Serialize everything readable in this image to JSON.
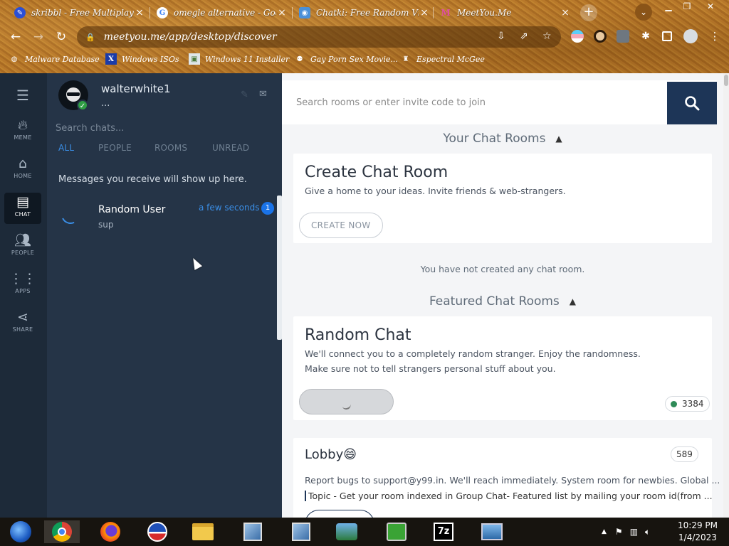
{
  "browser": {
    "tabs": [
      {
        "title": "skribbl - Free Multiplayer",
        "close": "×"
      },
      {
        "title": "omegle alternative - Goog",
        "close": "×"
      },
      {
        "title": "Chatki: Free Random Video",
        "close": "×"
      },
      {
        "title": "MeetYou.Me",
        "close": "×"
      }
    ],
    "new_tab": "+",
    "url": "meetyou.me/app/desktop/discover",
    "bookmarks": [
      {
        "label": "Malware Database"
      },
      {
        "label": "Windows ISOs"
      },
      {
        "label": "Windows 11 Installer"
      },
      {
        "label": "Gay Porn Sex Movie..."
      },
      {
        "label": "Espectral McGee"
      }
    ]
  },
  "rail": {
    "items": [
      {
        "label": "MEME",
        "icon": "flame-icon"
      },
      {
        "label": "HOME",
        "icon": "home-icon"
      },
      {
        "label": "CHAT",
        "icon": "chat-icon"
      },
      {
        "label": "PEOPLE",
        "icon": "people-icon"
      },
      {
        "label": "APPS",
        "icon": "apps-icon"
      },
      {
        "label": "SHARE",
        "icon": "share-icon"
      }
    ]
  },
  "chat_panel": {
    "username": "walterwhite1",
    "status": "...",
    "search_placeholder": "Search chats...",
    "filters": [
      "ALL",
      "PEOPLE",
      "ROOMS",
      "UNREAD"
    ],
    "empty_message": "Messages you receive will show up here.",
    "chats": [
      {
        "name": "Random User",
        "preview": "sup",
        "time": "a few seconds",
        "unread": "1"
      }
    ]
  },
  "main": {
    "search_placeholder": "Search rooms or enter invite code to join",
    "your_rooms_heading": "Your Chat Rooms",
    "create_card": {
      "title": "Create Chat Room",
      "desc": "Give a home to your ideas. Invite friends & web-strangers.",
      "button": "CREATE NOW"
    },
    "no_rooms": "You have not created any chat room.",
    "featured_heading": "Featured Chat Rooms",
    "random_card": {
      "title": "Random Chat",
      "desc1": "We'll connect you to a completely random stranger. Enjoy the randomness.",
      "desc2": "Make sure not to tell strangers personal stuff about you.",
      "online": "3384"
    },
    "lobby_card": {
      "title": "Lobby😄",
      "members": "589",
      "desc": "Report bugs to support@y99.in. We'll reach immediately. System room for newbies. Global ...",
      "topic": "Topic - Get your room indexed in Group Chat- Featured list by mailing your room id(from ..."
    }
  },
  "taskbar": {
    "time": "10:29 PM",
    "date": "1/4/2023"
  },
  "colors": {
    "accent_blue": "#3a8ee6",
    "search_button": "#1d3557",
    "panel_bg": "#253447",
    "rail_bg": "#1d2a39",
    "online_green": "#2e8b57"
  }
}
